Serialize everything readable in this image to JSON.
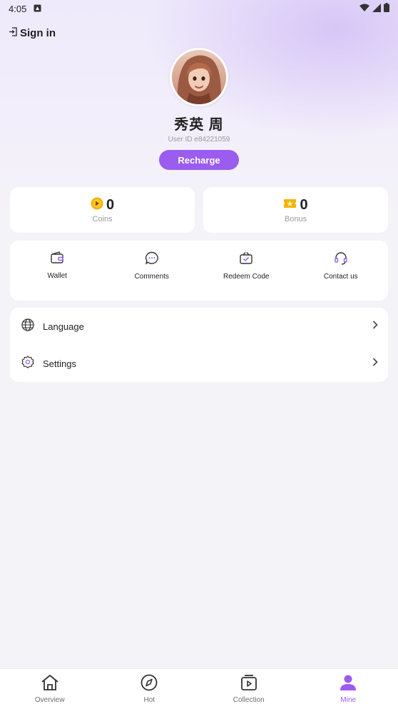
{
  "status_bar": {
    "time": "4:05"
  },
  "header": {
    "sign_in_label": "Sign in"
  },
  "profile": {
    "name": "秀英 周",
    "user_id": "User ID e84221059",
    "recharge_label": "Recharge"
  },
  "stats": {
    "coins": {
      "value": "0",
      "label": "Coins"
    },
    "bonus": {
      "value": "0",
      "label": "Bonus"
    }
  },
  "actions": [
    {
      "label": "Wallet",
      "icon": "wallet-icon"
    },
    {
      "label": "Comments",
      "icon": "comment-icon"
    },
    {
      "label": "Redeem Code",
      "icon": "redeem-icon"
    },
    {
      "label": "Contact us",
      "icon": "headset-icon"
    }
  ],
  "menu": [
    {
      "label": "Language",
      "icon": "globe-icon"
    },
    {
      "label": "Settings",
      "icon": "gear-icon"
    }
  ],
  "tabs": [
    {
      "label": "Overview",
      "icon": "home-icon"
    },
    {
      "label": "Hot",
      "icon": "compass-icon"
    },
    {
      "label": "Collection",
      "icon": "play-box-icon"
    },
    {
      "label": "Mine",
      "icon": "user-icon",
      "active": true
    }
  ],
  "colors": {
    "accent": "#9b5cf0",
    "coin": "#f5b300"
  }
}
